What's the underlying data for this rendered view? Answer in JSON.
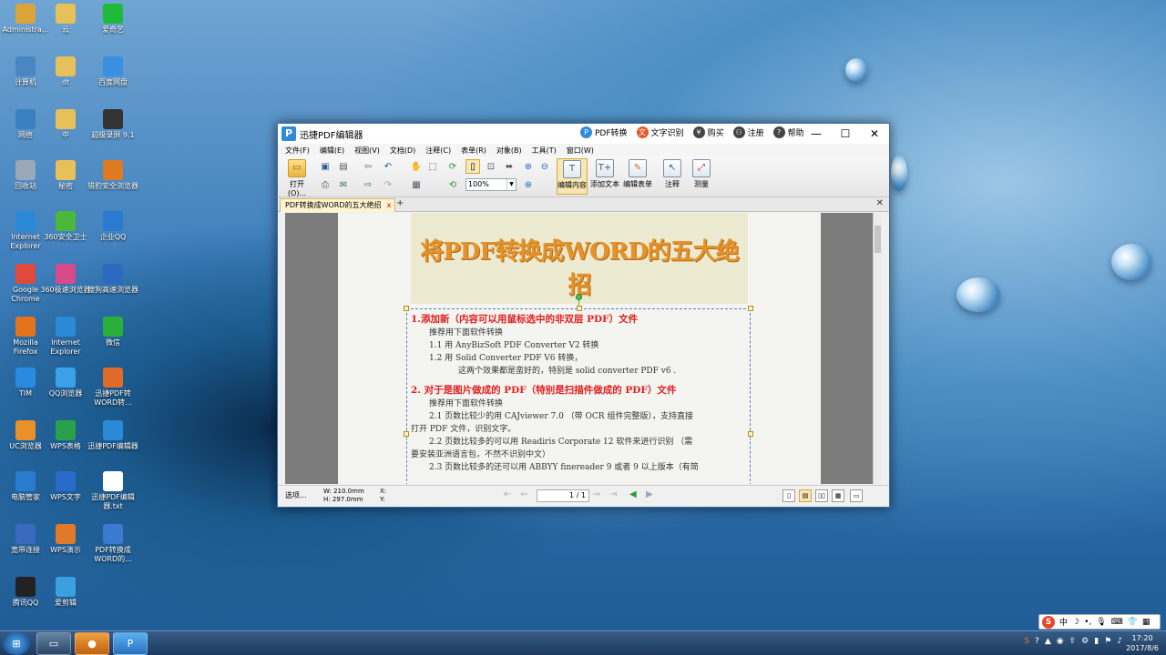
{
  "desktop": {
    "icons": [
      {
        "label": "Administra...",
        "icon": "user-folder-icon",
        "color": "#d9a43a"
      },
      {
        "label": "云",
        "icon": "folder-icon",
        "color": "#e6c15a"
      },
      {
        "label": "爱奇艺",
        "icon": "iqiyi-icon",
        "color": "#1fba3a"
      },
      {
        "label": "计算机",
        "icon": "computer-icon",
        "color": "#4a86c4"
      },
      {
        "label": "dt",
        "icon": "folder-icon",
        "color": "#e6c15a"
      },
      {
        "label": "百度网盘",
        "icon": "baidu-netdisk-icon",
        "color": "#3a8fe0"
      },
      {
        "label": "网络",
        "icon": "network-icon",
        "color": "#3a7fc0"
      },
      {
        "label": "中",
        "icon": "folder-icon",
        "color": "#e6c15a"
      },
      {
        "label": "超级录屏 9.1",
        "icon": "screen-recorder-icon",
        "color": "#333333"
      },
      {
        "label": "回收站",
        "icon": "recycle-bin-icon",
        "color": "#9aa8b8"
      },
      {
        "label": "秘密",
        "icon": "folder-icon",
        "color": "#e6c15a"
      },
      {
        "label": "猎豹安全浏览器",
        "icon": "liebao-browser-icon",
        "color": "#e07a20"
      },
      {
        "label": "Internet Explorer",
        "icon": "ie-icon",
        "color": "#2a8ad8"
      },
      {
        "label": "360安全卫士",
        "icon": "360-security-icon",
        "color": "#4ab83a"
      },
      {
        "label": "企业QQ",
        "icon": "enterprise-qq-icon",
        "color": "#2a7ad0"
      },
      {
        "label": "Google Chrome",
        "icon": "chrome-icon",
        "color": "#e04a3a"
      },
      {
        "label": "360极速浏览器",
        "icon": "360-browser-icon",
        "color": "#d84a8a"
      },
      {
        "label": "搜狗高速浏览器",
        "icon": "sogou-browser-icon",
        "color": "#2a6ac0"
      },
      {
        "label": "Mozilla Firefox",
        "icon": "firefox-icon",
        "color": "#e2731a"
      },
      {
        "label": "Internet Explorer",
        "icon": "ie-icon",
        "color": "#2a8ad8"
      },
      {
        "label": "微信",
        "icon": "wechat-icon",
        "color": "#2ab03a"
      },
      {
        "label": "TIM",
        "icon": "tim-icon",
        "color": "#2a8ae0"
      },
      {
        "label": "QQ浏览器",
        "icon": "qq-browser-icon",
        "color": "#3aa0e8"
      },
      {
        "label": "迅捷PDF转WORD转...",
        "icon": "pdf-converter-icon",
        "color": "#e06a2a"
      },
      {
        "label": "UC浏览器",
        "icon": "uc-browser-icon",
        "color": "#e8902a"
      },
      {
        "label": "WPS表格",
        "icon": "wps-sheet-icon",
        "color": "#2aa04a"
      },
      {
        "label": "迅捷PDF编辑器",
        "icon": "pdf-editor-icon",
        "color": "#2a8ad8"
      },
      {
        "label": "电脑管家",
        "icon": "pc-manager-icon",
        "color": "#2a7ad0"
      },
      {
        "label": "WPS文字",
        "icon": "wps-writer-icon",
        "color": "#2a6ac8"
      },
      {
        "label": "迅捷PDF编辑器.txt",
        "icon": "txt-file-icon",
        "color": "#ffffff"
      },
      {
        "label": "宽带连接",
        "icon": "broadband-icon",
        "color": "#3a6ac0"
      },
      {
        "label": "WPS演示",
        "icon": "wps-presentation-icon",
        "color": "#e07a2a"
      },
      {
        "label": "PDF转换成WORD的...",
        "icon": "pdf-file-icon",
        "color": "#3a7ad0"
      },
      {
        "label": "腾讯QQ",
        "icon": "qq-icon",
        "color": "#222222"
      },
      {
        "label": "爱剪辑",
        "icon": "aijianji-icon",
        "color": "#3aa0e0"
      }
    ]
  },
  "window": {
    "logo": "P",
    "title": "迅捷PDF编辑器",
    "actions": [
      {
        "label": "PDF转换",
        "icon": "pdf-convert-icon",
        "color": "#2f8ad8",
        "glyph": "P"
      },
      {
        "label": "文字识别",
        "icon": "ocr-icon",
        "color": "#e05a2a",
        "glyph": "文"
      },
      {
        "label": "购买",
        "icon": "buy-icon",
        "color": "#444444",
        "glyph": "¥"
      },
      {
        "label": "注册",
        "icon": "register-icon",
        "color": "#444444",
        "glyph": "⚇"
      },
      {
        "label": "帮助",
        "icon": "help-icon",
        "color": "#444444",
        "glyph": "?"
      }
    ],
    "controls": {
      "minimize": "—",
      "maximize": "☐",
      "close": "✕"
    }
  },
  "menu": [
    "文件(F)",
    "编辑(E)",
    "视图(V)",
    "文档(D)",
    "注释(C)",
    "表单(R)",
    "对象(B)",
    "工具(T)",
    "窗口(W)"
  ],
  "toolbar": {
    "open_label": "打开(O)...",
    "zoom_value": "100%",
    "edit_content_label": "编辑内容",
    "add_text_label": "添加文本",
    "edit_form_label": "编辑表单",
    "annotate_label": "注释",
    "measure_label": "测量"
  },
  "tabs": {
    "active": "PDF转换成WORD的五大绝招",
    "close": "x",
    "add": "+",
    "close_all": "✕"
  },
  "document": {
    "title": "将PDF转换成WORD的五大绝招",
    "lines": [
      {
        "text": "1.添加新（内容可以用鼠标选中的非双层 PDF）文件",
        "style": "heading"
      },
      {
        "text": "推荐用下面软件转换",
        "style": "ind1"
      },
      {
        "text": "1.1 用 AnyBizSoft PDF Converter V2 转换",
        "style": "ind1"
      },
      {
        "text": "1.2 用 Solid Converter PDF V6  转换，",
        "style": "ind1"
      },
      {
        "text": "这两个效果都是蛮好的，特别是 solid converter PDF v6 .",
        "style": "ind2"
      },
      {
        "text": "2.  对于是图片做成的 PDF（特别是扫描件做成的 PDF）文件",
        "style": "heading"
      },
      {
        "text": "推荐用下面软件转换",
        "style": "ind1"
      },
      {
        "text": "2.1  页数比较少的用 CAJviewer 7.0 （带 OCR 组件完整版），支持直接",
        "style": "ind1"
      },
      {
        "text": "打开 PDF 文件，识别文字。",
        "style": "plain"
      },
      {
        "text": "2.2  页数比较多的可以用 Readiris Corporate 12 软件来进行识别 （需",
        "style": "ind1"
      },
      {
        "text": "要安装亚洲语言包，不然不识别中文）",
        "style": "plain"
      },
      {
        "text": "2.3  页数比较多的还可以用 ABBYY finereader 9 或者 9 以上版本（有简",
        "style": "ind1"
      }
    ]
  },
  "statusbar": {
    "select": "选项...",
    "width": "W: 210.0mm",
    "height": "H: 297.0mm",
    "x": "X:",
    "y": "Y:",
    "page": "1 / 1"
  },
  "taskbar": {
    "start": "⊞",
    "time": "17:20",
    "date": "2017/8/6",
    "ime_label": "中"
  }
}
